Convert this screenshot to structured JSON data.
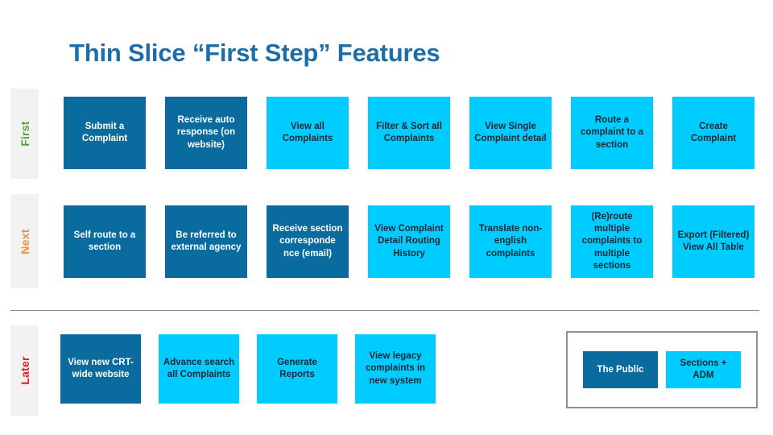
{
  "slide": {
    "title": "Thin Slice “First Step” Features"
  },
  "colors": {
    "title": "#1b6ea8",
    "dark_card": "#0a6b9e",
    "light_card": "#00ccff",
    "strip_background": "#f2f2f2",
    "divider": "#8a8a8a",
    "legend_border": "#8f8f8f",
    "label_first": "#5aa03c",
    "label_next": "#e89336",
    "label_later": "#e02020"
  },
  "rows": [
    {
      "label": "First",
      "cards": [
        {
          "text": "Submit a Complaint",
          "style": "dark"
        },
        {
          "text": "Receive auto response (on website)",
          "style": "dark"
        },
        {
          "text": "View all Complaints",
          "style": "light"
        },
        {
          "text": "Filter & Sort all Complaints",
          "style": "light"
        },
        {
          "text": "View Single Complaint detail",
          "style": "light"
        },
        {
          "text": "Route a complaint to a section",
          "style": "light"
        },
        {
          "text": "Create Complaint",
          "style": "light"
        }
      ]
    },
    {
      "label": "Next",
      "cards": [
        {
          "text": "Self route to a section",
          "style": "dark"
        },
        {
          "text": "Be referred to external agency",
          "style": "dark"
        },
        {
          "text": "Receive section corresponde nce  (email)",
          "style": "dark"
        },
        {
          "text": "View Complaint Detail Routing History",
          "style": "light"
        },
        {
          "text": "Translate non-english complaints",
          "style": "light"
        },
        {
          "text": "(Re)route multiple complaints to multiple sections",
          "style": "light"
        },
        {
          "text": "Export (Filtered) View All Table",
          "style": "light"
        }
      ]
    },
    {
      "label": "Later",
      "cards": [
        {
          "text": "View new CRT-wide website",
          "style": "dark"
        },
        {
          "text": "Advance search all Complaints",
          "style": "light"
        },
        {
          "text": "Generate Reports",
          "style": "light"
        },
        {
          "text": "View legacy complaints in new system",
          "style": "light"
        }
      ]
    }
  ],
  "legend": {
    "public_label": "The Public",
    "sections_label": "Sections + ADM"
  }
}
